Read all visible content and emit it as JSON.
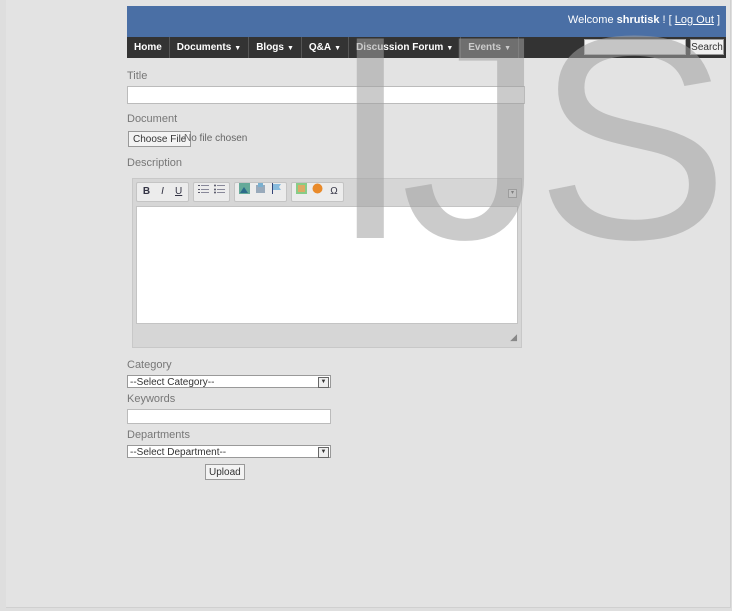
{
  "header": {
    "welcome_prefix": "Welcome",
    "username": "shrutisk",
    "welcome_suffix": "! [",
    "logout_label": "Log Out",
    "bracket_close": "]"
  },
  "nav": {
    "items": [
      {
        "label": "Home",
        "dropdown": false
      },
      {
        "label": "Documents",
        "dropdown": true
      },
      {
        "label": "Blogs",
        "dropdown": true
      },
      {
        "label": "Q&A",
        "dropdown": true
      },
      {
        "label": "Discussion Forum",
        "dropdown": true
      },
      {
        "label": "Events",
        "dropdown": true
      }
    ],
    "caret": "▼",
    "search_placeholder": "",
    "search_label": "Search"
  },
  "form": {
    "title_label": "Title",
    "title_value": "",
    "document_label": "Document",
    "choose_file_label": "Choose File",
    "no_file_text": "No file chosen",
    "description_label": "Description",
    "category_label": "Category",
    "category_selected": "--Select Category--",
    "keywords_label": "Keywords",
    "keywords_value": "",
    "departments_label": "Departments",
    "department_selected": "--Select Department--",
    "upload_label": "Upload"
  },
  "editor": {
    "bold": "B",
    "italic": "I",
    "underline": "U",
    "special_char": "Ω"
  },
  "watermark": "IJS",
  "colors": {
    "header_blue": "#4a6fa5",
    "nav_dark": "#333333"
  }
}
